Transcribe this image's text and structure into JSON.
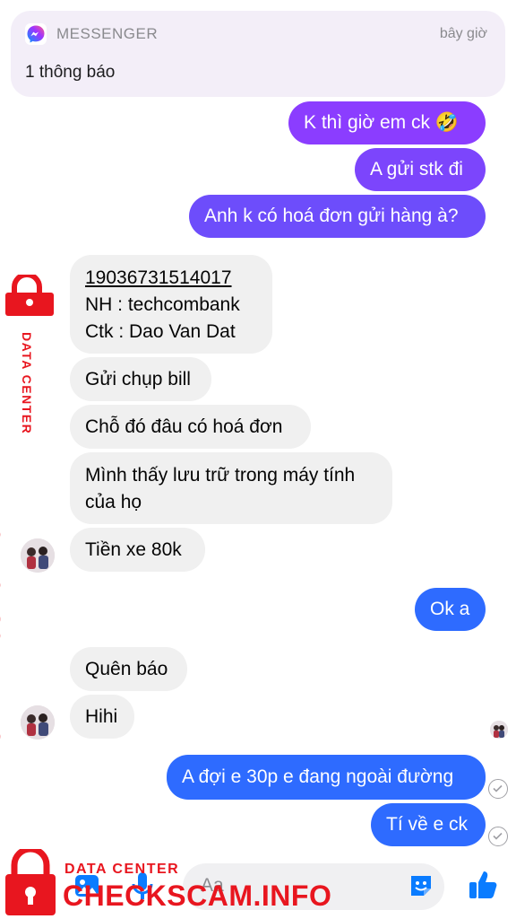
{
  "notification": {
    "app": "MESSENGER",
    "time": "bây giờ",
    "body": "1 thông báo"
  },
  "messages": [
    {
      "side": "outgoing",
      "text": "K thì giờ em ck 🤣"
    },
    {
      "side": "outgoing",
      "text": "A gửi stk đi"
    },
    {
      "side": "outgoing",
      "text": "Anh k có hoá đơn gửi hàng à?"
    },
    {
      "side": "incoming",
      "lines": [
        "19036731514017",
        "NH : techcombank",
        "Ctk : Dao Van Dat"
      ]
    },
    {
      "side": "incoming",
      "text": "Gửi chụp bill"
    },
    {
      "side": "incoming",
      "text": "Chỗ đó đâu có hoá đơn"
    },
    {
      "side": "incoming",
      "lines": [
        "Mình thấy lưu trữ trong máy tính",
        "của họ"
      ]
    },
    {
      "side": "incoming",
      "text": "Tiền xe 80k"
    },
    {
      "side": "outgoing",
      "text": "Ok a"
    },
    {
      "side": "incoming",
      "text": "Quên báo"
    },
    {
      "side": "incoming",
      "text": "Hihi"
    },
    {
      "side": "outgoing",
      "text": "A đợi e 30p e đang ngoài đường"
    },
    {
      "side": "outgoing",
      "text": "Tí về e ck"
    }
  ],
  "composer": {
    "placeholder": "Aa"
  },
  "watermark": {
    "label": "DATA CENTER",
    "brand": "CHECKSCAM.INFO"
  },
  "colors": {
    "purple": "#8b3dff",
    "violet": "#6d4dfb",
    "blue": "#2e6bff",
    "incoming_bg": "#f0f0f0",
    "watermark_red": "#e8161f",
    "accent_blue": "#0a7cff"
  },
  "icons": [
    "messenger-logo-icon",
    "camera-icon",
    "gallery-icon",
    "microphone-icon",
    "sticker-icon",
    "thumbs-up-icon",
    "read-receipt-avatar-icon",
    "sent-check-icon",
    "padlock-icon"
  ]
}
